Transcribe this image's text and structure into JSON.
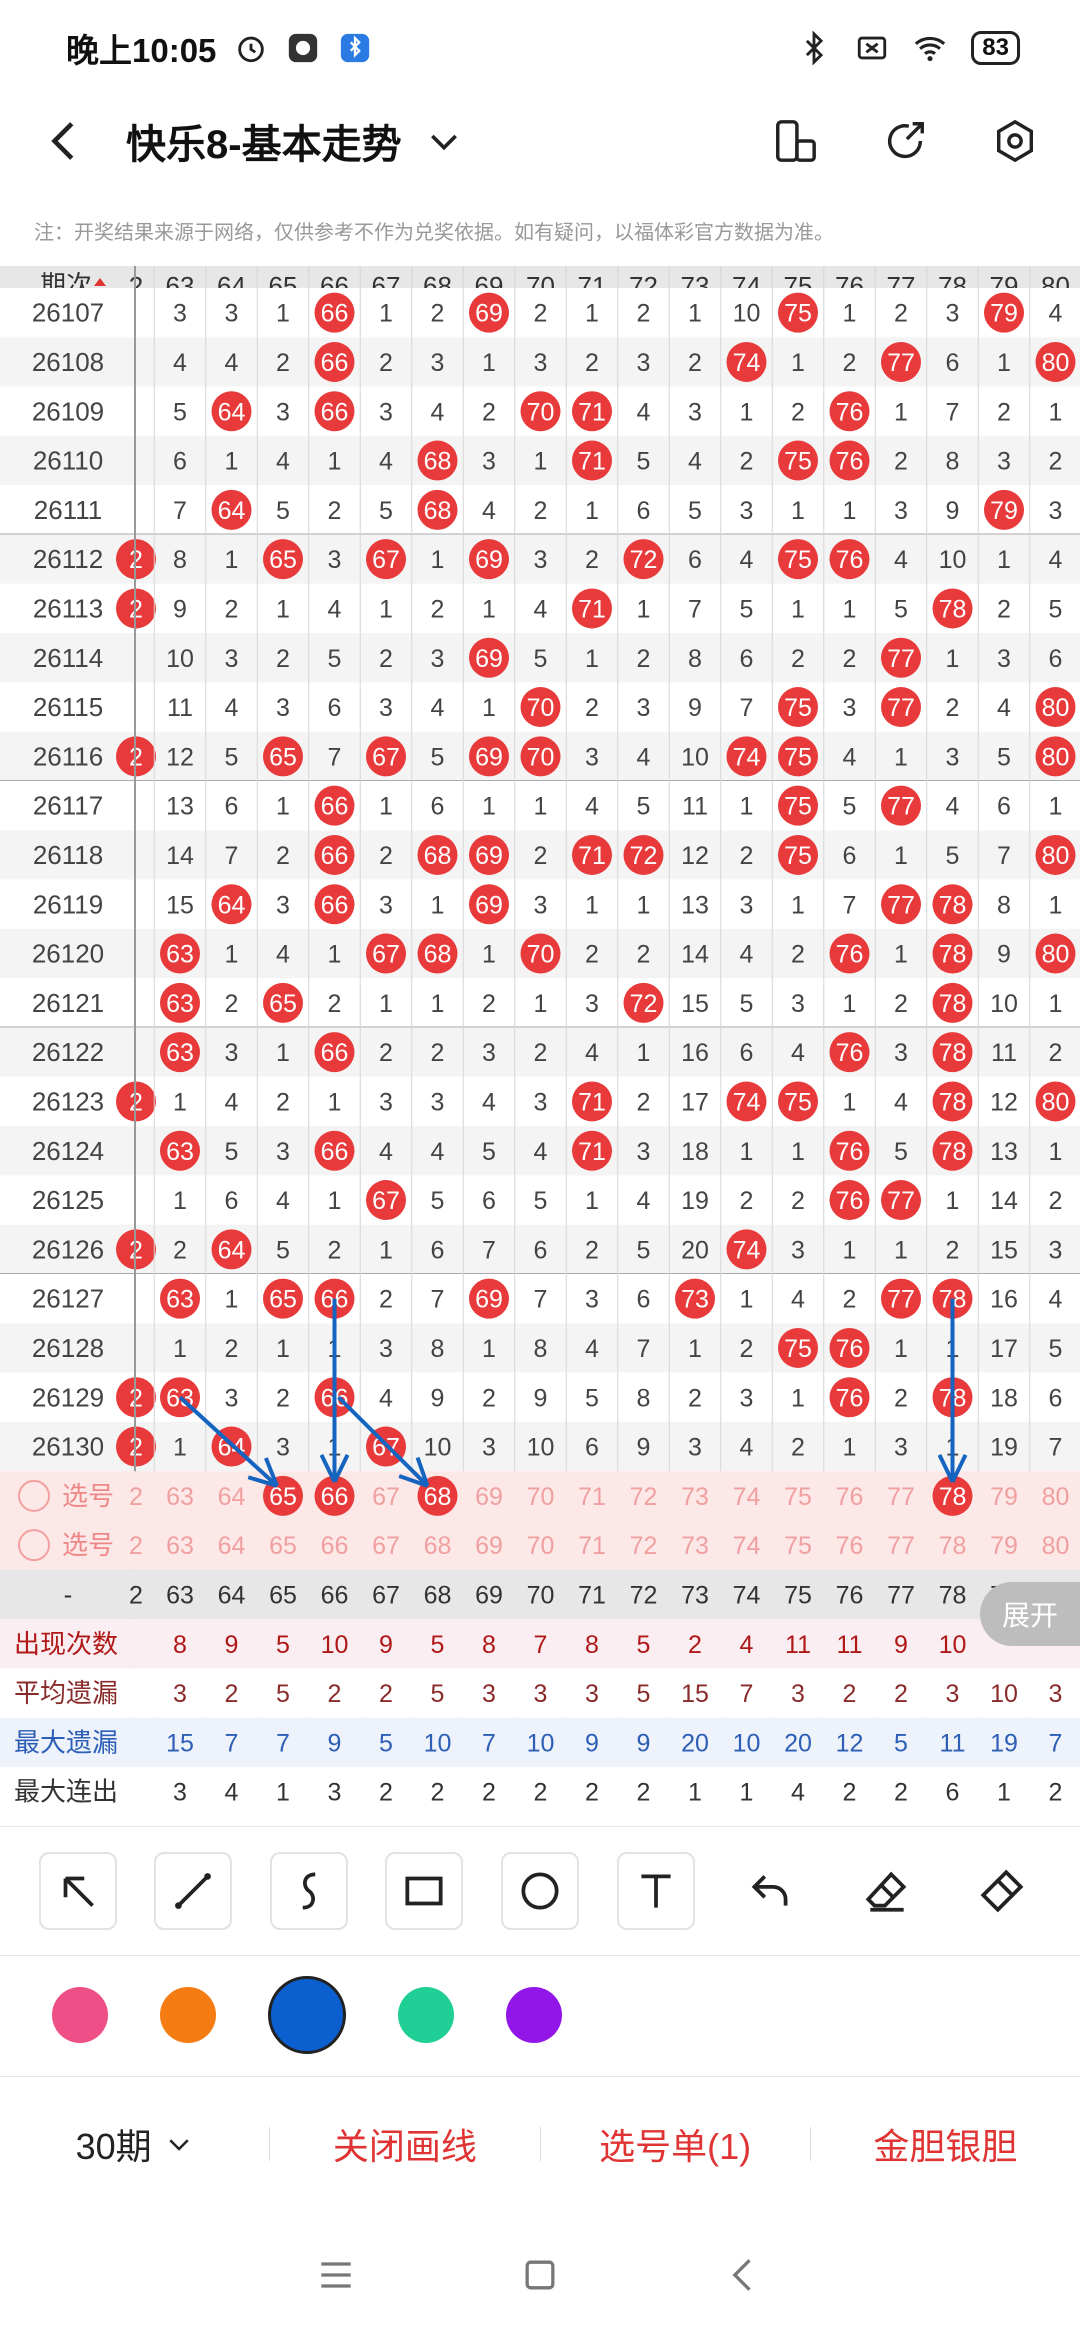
{
  "status": {
    "time": "晚上10:05",
    "battery": "83"
  },
  "header": {
    "title": "快乐8-基本走势"
  },
  "notice": "注：开奖结果来源于网络，仅供参考不作为兑奖依据。如有疑问，以福体彩官方数据为准。",
  "table": {
    "issue_label": "期次",
    "columns": [
      "2",
      "63",
      "64",
      "65",
      "66",
      "67",
      "68",
      "69",
      "70",
      "71",
      "72",
      "73",
      "74",
      "75",
      "76",
      "77",
      "78",
      "79",
      "80"
    ],
    "rows": [
      {
        "issue": "26107",
        "cells": [
          "",
          "3",
          "3",
          "1",
          "66",
          "1",
          "2",
          "69",
          "2",
          "1",
          "2",
          "1",
          "10",
          "75",
          "1",
          "2",
          "3",
          "79",
          "4"
        ]
      },
      {
        "issue": "26108",
        "cells": [
          "",
          "4",
          "4",
          "2",
          "66",
          "2",
          "3",
          "1",
          "3",
          "2",
          "3",
          "2",
          "74",
          "1",
          "2",
          "77",
          "6",
          "1",
          "80"
        ]
      },
      {
        "issue": "26109",
        "cells": [
          "",
          "5",
          "64",
          "3",
          "66",
          "3",
          "4",
          "2",
          "70",
          "71",
          "4",
          "3",
          "1",
          "2",
          "76",
          "1",
          "7",
          "2",
          "1"
        ]
      },
      {
        "issue": "26110",
        "cells": [
          "",
          "6",
          "1",
          "4",
          "1",
          "4",
          "68",
          "3",
          "1",
          "71",
          "5",
          "4",
          "2",
          "75",
          "76",
          "2",
          "8",
          "3",
          "2"
        ]
      },
      {
        "issue": "26111",
        "cells": [
          "",
          "7",
          "64",
          "5",
          "2",
          "5",
          "68",
          "4",
          "2",
          "1",
          "6",
          "5",
          "3",
          "1",
          "1",
          "3",
          "9",
          "79",
          "3"
        ]
      },
      {
        "issue": "26112",
        "cells": [
          "2",
          "8",
          "1",
          "65",
          "3",
          "67",
          "1",
          "69",
          "3",
          "2",
          "72",
          "6",
          "4",
          "75",
          "76",
          "4",
          "10",
          "1",
          "4"
        ]
      },
      {
        "issue": "26113",
        "cells": [
          "2",
          "9",
          "2",
          "1",
          "4",
          "1",
          "2",
          "1",
          "4",
          "71",
          "1",
          "7",
          "5",
          "1",
          "1",
          "5",
          "78",
          "2",
          "5"
        ]
      },
      {
        "issue": "26114",
        "cells": [
          "",
          "10",
          "3",
          "2",
          "5",
          "2",
          "3",
          "69",
          "5",
          "1",
          "2",
          "8",
          "6",
          "2",
          "2",
          "77",
          "1",
          "3",
          "6"
        ]
      },
      {
        "issue": "26115",
        "cells": [
          "",
          "11",
          "4",
          "3",
          "6",
          "3",
          "4",
          "1",
          "70",
          "2",
          "3",
          "9",
          "7",
          "75",
          "3",
          "77",
          "2",
          "4",
          "80"
        ]
      },
      {
        "issue": "26116",
        "cells": [
          "2",
          "12",
          "5",
          "65",
          "7",
          "67",
          "5",
          "69",
          "70",
          "3",
          "4",
          "10",
          "74",
          "75",
          "4",
          "1",
          "3",
          "5",
          "80"
        ]
      },
      {
        "issue": "26117",
        "cells": [
          "",
          "13",
          "6",
          "1",
          "66",
          "1",
          "6",
          "1",
          "1",
          "4",
          "5",
          "11",
          "1",
          "75",
          "5",
          "77",
          "4",
          "6",
          "1"
        ]
      },
      {
        "issue": "26118",
        "cells": [
          "",
          "14",
          "7",
          "2",
          "66",
          "2",
          "68",
          "69",
          "2",
          "71",
          "72",
          "12",
          "2",
          "75",
          "6",
          "1",
          "5",
          "7",
          "80"
        ]
      },
      {
        "issue": "26119",
        "cells": [
          "",
          "15",
          "64",
          "3",
          "66",
          "3",
          "1",
          "69",
          "3",
          "1",
          "1",
          "13",
          "3",
          "1",
          "7",
          "77",
          "78",
          "8",
          "1"
        ]
      },
      {
        "issue": "26120",
        "cells": [
          "",
          "63",
          "1",
          "4",
          "1",
          "67",
          "68",
          "1",
          "70",
          "2",
          "2",
          "14",
          "4",
          "2",
          "76",
          "1",
          "78",
          "9",
          "80"
        ]
      },
      {
        "issue": "26121",
        "cells": [
          "",
          "63",
          "2",
          "65",
          "2",
          "1",
          "1",
          "2",
          "1",
          "3",
          "72",
          "15",
          "5",
          "3",
          "1",
          "2",
          "78",
          "10",
          "1"
        ]
      },
      {
        "issue": "26122",
        "cells": [
          "",
          "63",
          "3",
          "1",
          "66",
          "2",
          "2",
          "3",
          "2",
          "4",
          "1",
          "16",
          "6",
          "4",
          "76",
          "3",
          "78",
          "11",
          "2"
        ]
      },
      {
        "issue": "26123",
        "cells": [
          "2",
          "1",
          "4",
          "2",
          "1",
          "3",
          "3",
          "4",
          "3",
          "71",
          "2",
          "17",
          "74",
          "75",
          "1",
          "4",
          "78",
          "12",
          "80"
        ]
      },
      {
        "issue": "26124",
        "cells": [
          "",
          "63",
          "5",
          "3",
          "66",
          "4",
          "4",
          "5",
          "4",
          "71",
          "3",
          "18",
          "1",
          "1",
          "76",
          "5",
          "78",
          "13",
          "1"
        ]
      },
      {
        "issue": "26125",
        "cells": [
          "",
          "1",
          "6",
          "4",
          "1",
          "67",
          "5",
          "6",
          "5",
          "1",
          "4",
          "19",
          "2",
          "2",
          "76",
          "77",
          "1",
          "14",
          "2"
        ]
      },
      {
        "issue": "26126",
        "cells": [
          "2",
          "2",
          "64",
          "5",
          "2",
          "1",
          "6",
          "7",
          "6",
          "2",
          "5",
          "20",
          "74",
          "3",
          "1",
          "1",
          "2",
          "15",
          "3"
        ]
      },
      {
        "issue": "26127",
        "cells": [
          "",
          "63",
          "1",
          "65",
          "66",
          "2",
          "7",
          "69",
          "7",
          "3",
          "6",
          "73",
          "1",
          "4",
          "2",
          "77",
          "78",
          "16",
          "4"
        ]
      },
      {
        "issue": "26128",
        "cells": [
          "",
          "1",
          "2",
          "1",
          "1",
          "3",
          "8",
          "1",
          "8",
          "4",
          "7",
          "1",
          "2",
          "75",
          "76",
          "1",
          "1",
          "17",
          "5"
        ]
      },
      {
        "issue": "26129",
        "cells": [
          "2",
          "63",
          "3",
          "2",
          "66",
          "4",
          "9",
          "2",
          "9",
          "5",
          "8",
          "2",
          "3",
          "1",
          "76",
          "2",
          "78",
          "18",
          "6"
        ]
      },
      {
        "issue": "26130",
        "cells": [
          "2",
          "1",
          "64",
          "3",
          "1",
          "67",
          "10",
          "3",
          "10",
          "6",
          "9",
          "3",
          "4",
          "2",
          "1",
          "3",
          "1",
          "19",
          "7"
        ]
      }
    ],
    "select_label": "选号",
    "select_rows": [
      {
        "selected": [
          "65",
          "66",
          "68",
          "78"
        ]
      },
      {
        "selected": []
      }
    ],
    "stats": [
      {
        "label": "出现次数",
        "values": [
          "",
          "8",
          "9",
          "5",
          "10",
          "9",
          "5",
          "8",
          "7",
          "8",
          "5",
          "2",
          "4",
          "11",
          "11",
          "9",
          "10",
          "",
          ""
        ]
      },
      {
        "label": "平均遗漏",
        "values": [
          "",
          "3",
          "2",
          "5",
          "2",
          "2",
          "5",
          "3",
          "3",
          "3",
          "5",
          "15",
          "7",
          "3",
          "2",
          "2",
          "3",
          "10",
          "3"
        ]
      },
      {
        "label": "最大遗漏",
        "values": [
          "",
          "15",
          "7",
          "7",
          "9",
          "5",
          "10",
          "7",
          "10",
          "9",
          "9",
          "20",
          "10",
          "20",
          "12",
          "5",
          "11",
          "19",
          "7"
        ]
      },
      {
        "label": "最大连出",
        "values": [
          "",
          "3",
          "4",
          "1",
          "3",
          "2",
          "2",
          "2",
          "2",
          "2",
          "2",
          "1",
          "1",
          "4",
          "2",
          "2",
          "6",
          "1",
          "2"
        ]
      }
    ],
    "stats_header_label": "-"
  },
  "expand_label": "展开",
  "colors": {
    "ball": "#e83a3a",
    "accent": "#e03333",
    "arrow": "#1565c0",
    "swatches": [
      "#ee4f86",
      "#f57c12",
      "#0b5fcf",
      "#1fcf96",
      "#9216e8"
    ]
  },
  "bottom": {
    "period": "30期",
    "close_draw": "关闭画线",
    "pick_list": "选号单(1)",
    "gold": "金胆银胆"
  }
}
